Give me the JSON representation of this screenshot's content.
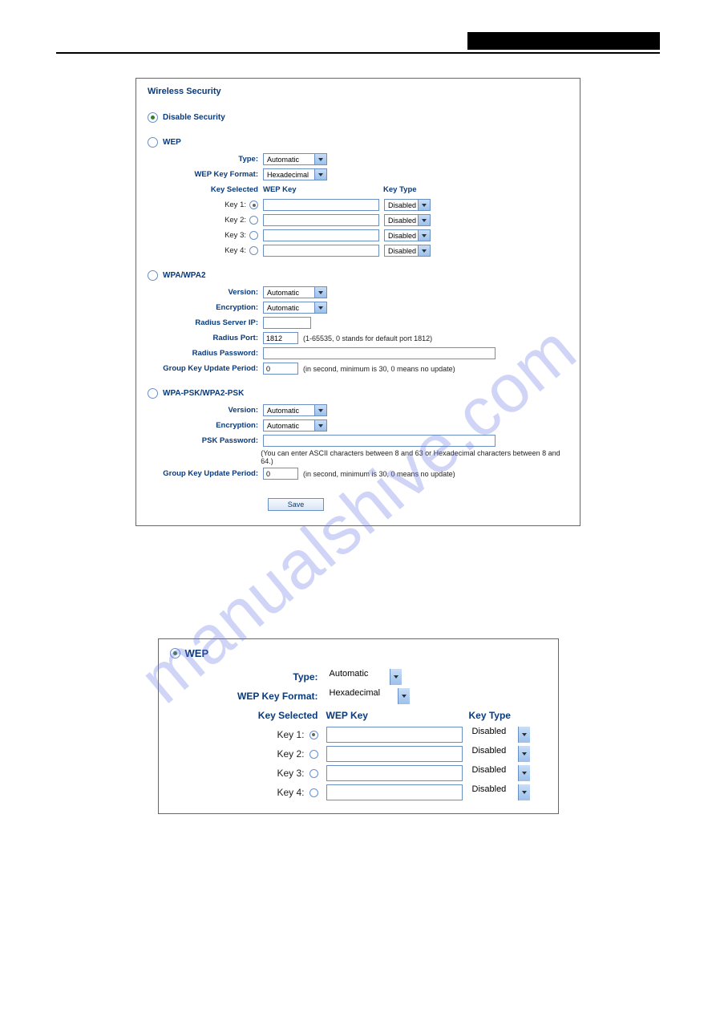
{
  "watermark": "manualshive.com",
  "panel1": {
    "title": "Wireless Security",
    "disable_security": "Disable Security",
    "wep": {
      "label": "WEP",
      "type_label": "Type:",
      "type_value": "Automatic",
      "format_label": "WEP Key Format:",
      "format_value": "Hexadecimal",
      "key_selected_header": "Key Selected",
      "wep_key_header": "WEP Key",
      "key_type_header": "Key Type",
      "keys": [
        {
          "label": "Key 1:",
          "selected": true,
          "value": "",
          "type": "Disabled"
        },
        {
          "label": "Key 2:",
          "selected": false,
          "value": "",
          "type": "Disabled"
        },
        {
          "label": "Key 3:",
          "selected": false,
          "value": "",
          "type": "Disabled"
        },
        {
          "label": "Key 4:",
          "selected": false,
          "value": "",
          "type": "Disabled"
        }
      ]
    },
    "wpa": {
      "label": "WPA/WPA2",
      "version_label": "Version:",
      "version_value": "Automatic",
      "encryption_label": "Encryption:",
      "encryption_value": "Automatic",
      "radius_ip_label": "Radius Server IP:",
      "radius_ip_value": "",
      "radius_port_label": "Radius Port:",
      "radius_port_value": "1812",
      "radius_port_hint": "(1-65535, 0 stands for default port 1812)",
      "radius_pwd_label": "Radius Password:",
      "radius_pwd_value": "",
      "group_key_label": "Group Key Update Period:",
      "group_key_value": "0",
      "group_key_hint": "(in second, minimum is 30, 0 means no update)"
    },
    "wpapsk": {
      "label": "WPA-PSK/WPA2-PSK",
      "version_label": "Version:",
      "version_value": "Automatic",
      "encryption_label": "Encryption:",
      "encryption_value": "Automatic",
      "psk_label": "PSK Password:",
      "psk_value": "",
      "psk_hint": "(You can enter ASCII characters between 8 and 63 or Hexadecimal characters between 8 and 64.)",
      "group_key_label": "Group Key Update Period:",
      "group_key_value": "0",
      "group_key_hint": "(in second, minimum is 30, 0 means no update)"
    },
    "save_label": "Save"
  },
  "panel2": {
    "label": "WEP",
    "type_label": "Type:",
    "type_value": "Automatic",
    "format_label": "WEP Key Format:",
    "format_value": "Hexadecimal",
    "key_selected_header": "Key Selected",
    "wep_key_header": "WEP Key",
    "key_type_header": "Key Type",
    "keys": [
      {
        "label": "Key 1:",
        "selected": true,
        "value": "",
        "type": "Disabled"
      },
      {
        "label": "Key 2:",
        "selected": false,
        "value": "",
        "type": "Disabled"
      },
      {
        "label": "Key 3:",
        "selected": false,
        "value": "",
        "type": "Disabled"
      },
      {
        "label": "Key 4:",
        "selected": false,
        "value": "",
        "type": "Disabled"
      }
    ]
  }
}
